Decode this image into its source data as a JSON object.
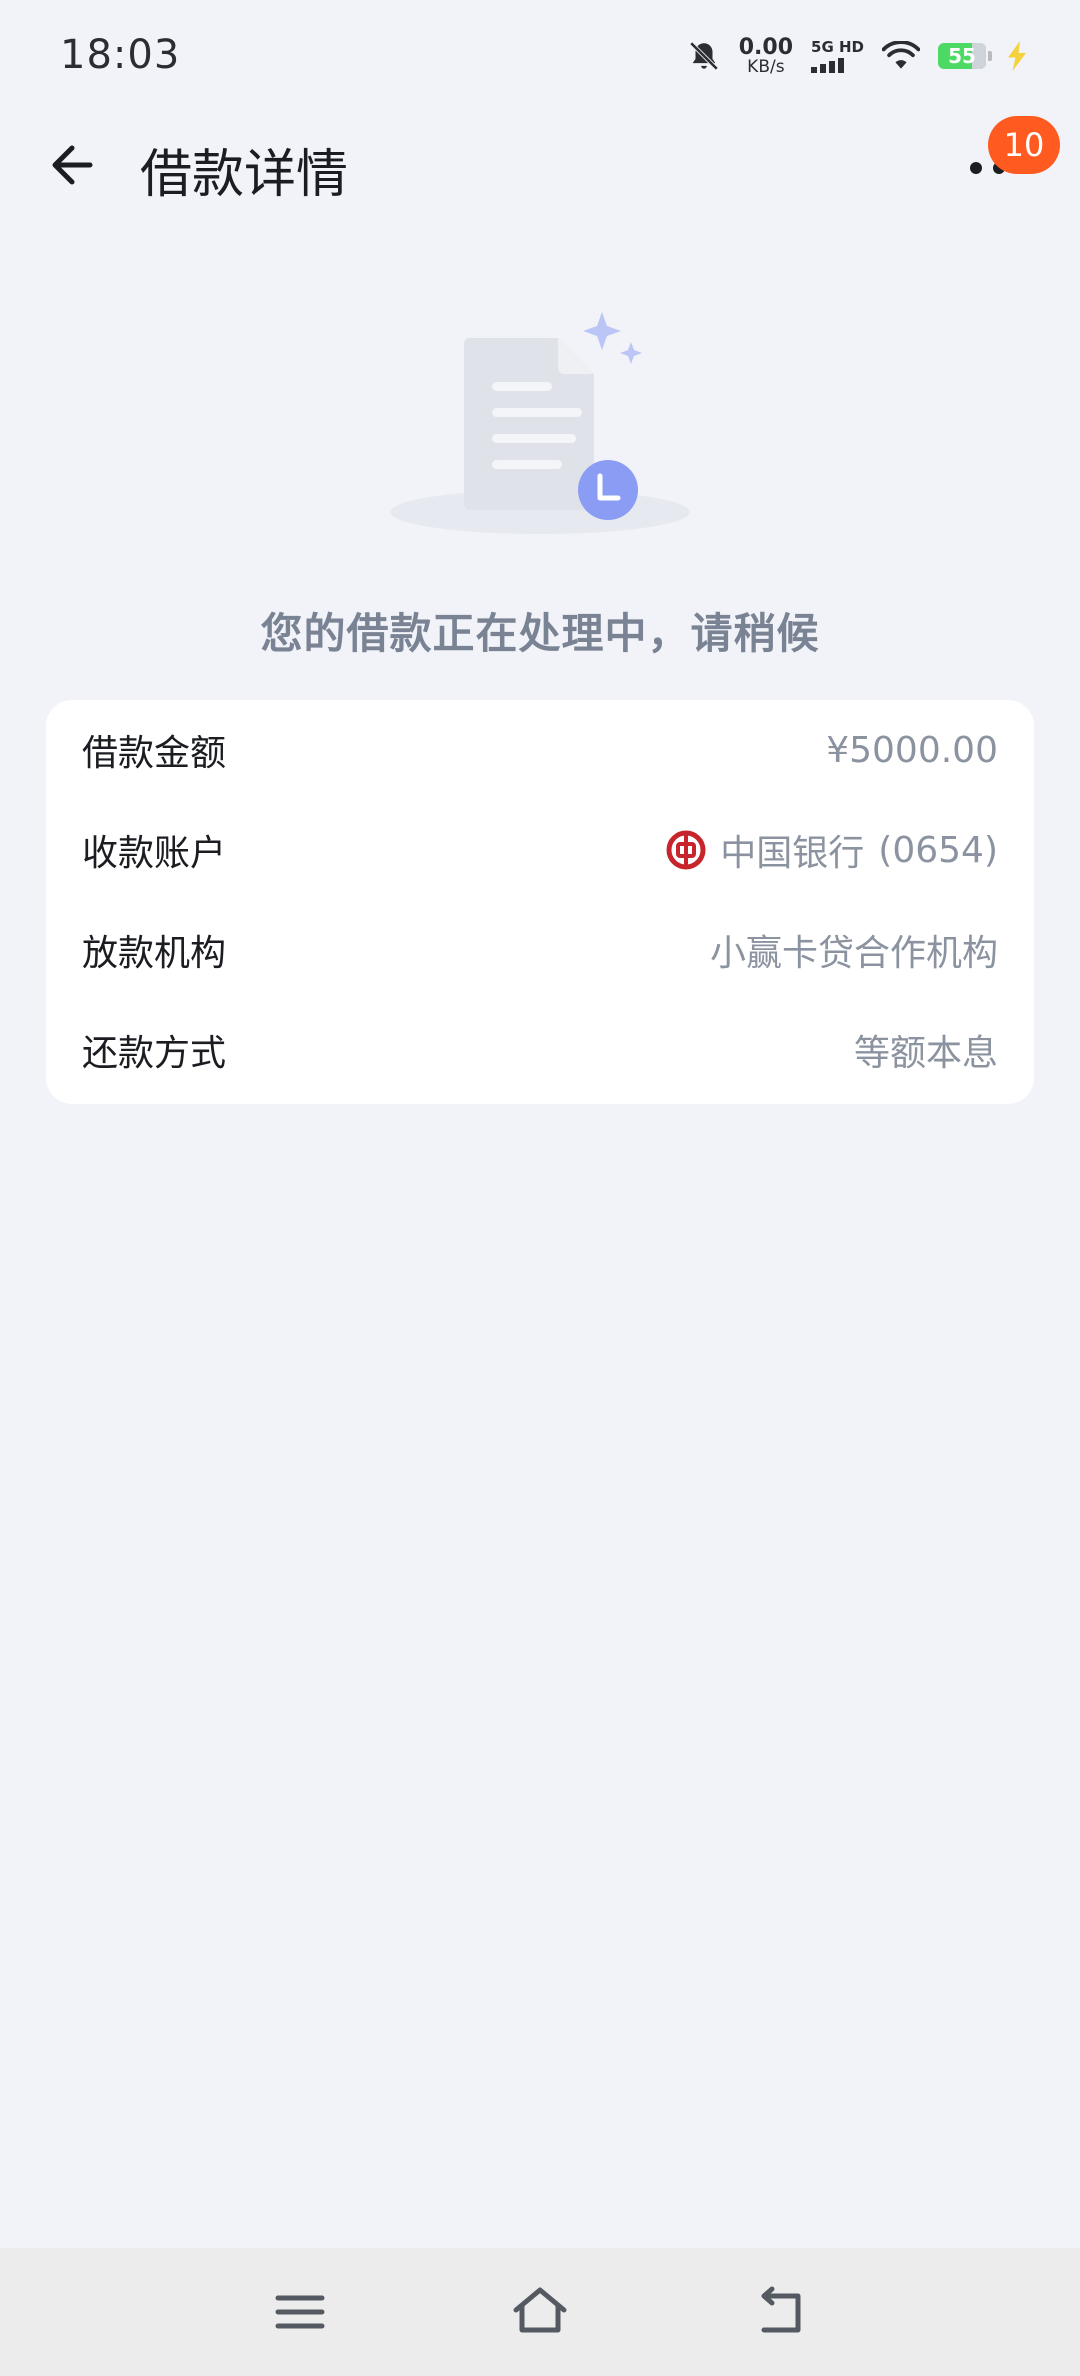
{
  "status_bar": {
    "time": "18:03",
    "net_speed_value": "0.00",
    "net_speed_unit": "KB/s",
    "network_label": "5G HD",
    "battery_level": "55",
    "icons": [
      "mute-icon",
      "signal-icon",
      "wifi-icon",
      "battery-icon",
      "charging-icon"
    ]
  },
  "header": {
    "title": "借款详情",
    "badge_count": "10"
  },
  "status_message": "您的借款正在处理中，请稍候",
  "details": {
    "rows": [
      {
        "label": "借款金额",
        "value": "¥5000.00"
      },
      {
        "label": "收款账户",
        "value": "中国银行",
        "suffix": "(0654)"
      },
      {
        "label": "放款机构",
        "value": "小赢卡贷合作机构"
      },
      {
        "label": "还款方式",
        "value": "等额本息"
      }
    ]
  },
  "colors": {
    "accent": "#ff5a1f",
    "clock_badge": "#8b9cf4",
    "bank_logo": "#c8242b"
  },
  "nav_bar": {
    "icons": [
      "menu-icon",
      "home-icon",
      "back-icon"
    ]
  }
}
